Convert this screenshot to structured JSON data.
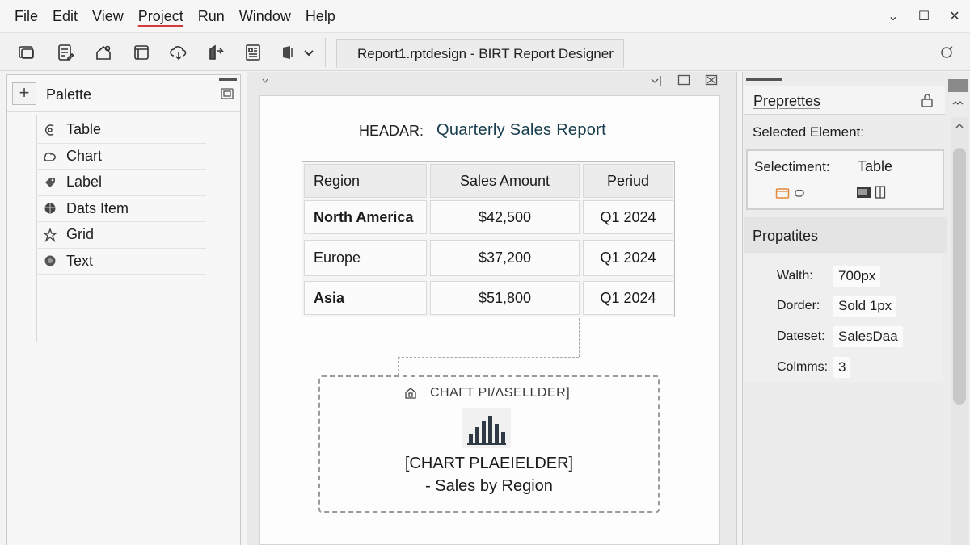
{
  "menu": {
    "items": [
      "File",
      "Edit",
      "View",
      "Project",
      "Run",
      "Window",
      "Help"
    ],
    "active_index": 3
  },
  "window_controls": {
    "minimize": "⌄",
    "maximize": "☐",
    "close": "✕"
  },
  "toolbar": {
    "tab_title": "Report1.rptdesign - BIRT Report Designer",
    "icons": [
      "new-report-icon",
      "edit-doc-icon",
      "save-icon",
      "layout-icon",
      "cloud-icon",
      "export-icon",
      "data-icon",
      "run-icon",
      "dropdown-chevron-icon"
    ]
  },
  "palette": {
    "title": "Palette",
    "plus": "+",
    "items": [
      {
        "label": "Table",
        "icon": "table-icon"
      },
      {
        "label": "Chart",
        "icon": "chart-icon"
      },
      {
        "label": "Label",
        "icon": "label-icon"
      },
      {
        "label": "Dats Item",
        "icon": "data-item-icon"
      },
      {
        "label": "Grid",
        "icon": "grid-icon"
      },
      {
        "label": "Text",
        "icon": "text-icon"
      }
    ]
  },
  "editor": {
    "header_label": "HEADAR:",
    "header_title": "Quarterly Sales Report",
    "table": {
      "columns": [
        "Region",
        "Sales Amount",
        "Periud"
      ],
      "rows": [
        {
          "region": "North America",
          "amount": "$42,500",
          "period": "Q1 2024"
        },
        {
          "region": "Europe",
          "amount": "$37,200",
          "period": "Q1 2024"
        },
        {
          "region": "Asia",
          "amount": "$51,800",
          "period": "Q1 2024"
        }
      ]
    },
    "chart": {
      "tag": "CHAΓT ΡΙ/ΛSELLDER]",
      "line1": "[CHART PLAEIELDER]",
      "line2": "- Sales by Region"
    }
  },
  "properties": {
    "title": "Preprettes",
    "selected_label": "Selected Element:",
    "selection_key": "Selectiment:",
    "selection_value": "Table",
    "section_title": "Propatites",
    "rows": [
      {
        "key": "Walth:",
        "value": "700px"
      },
      {
        "key": "Dorder:",
        "value": "Sold 1px"
      },
      {
        "key": "Dateset:",
        "value": "SalesDaa"
      },
      {
        "key": "Colmms:",
        "value": "3"
      }
    ]
  },
  "colors": {
    "accent_underline": "#d43b3b",
    "title_color": "#173d4d",
    "orange_icon": "#e0893a"
  }
}
